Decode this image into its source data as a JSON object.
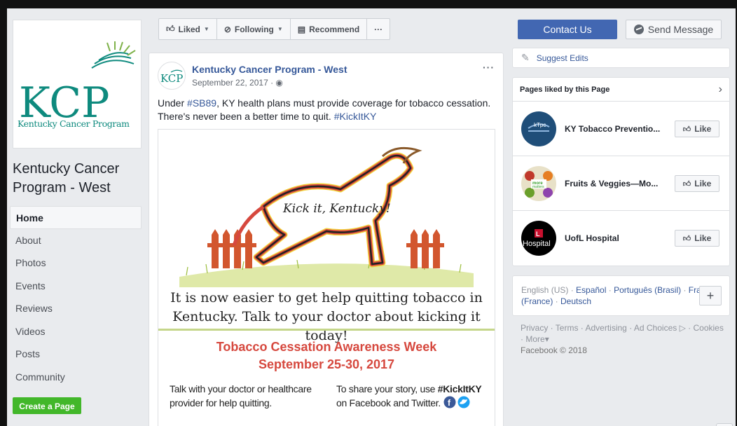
{
  "page": {
    "name": "Kentucky Cancer Program - West",
    "logo_letters": "KCP",
    "logo_tagline": "Kentucky Cancer Program"
  },
  "nav": {
    "items": [
      "Home",
      "About",
      "Photos",
      "Events",
      "Reviews",
      "Videos",
      "Posts",
      "Community"
    ],
    "active": "Home",
    "create_page": "Create a Page"
  },
  "actions": {
    "liked": "Liked",
    "following": "Following",
    "recommend": "Recommend",
    "more": "···",
    "contact_us": "Contact Us",
    "send_message": "Send Message"
  },
  "post": {
    "author": "Kentucky Cancer Program - West",
    "date": "September 22, 2017 · ",
    "more": "···",
    "text_before": "Under ",
    "tag1": "#SB89",
    "text_middle": ", KY health plans must provide coverage for tobacco cessation. There's never been a better time to quit. ",
    "tag2": "#KickItKY",
    "image": {
      "script_title": "Kick it, Kentucky!",
      "headline_line1": "It is now easier to get help quitting tobacco in",
      "headline_line2": "Kentucky. Talk to your doctor about kicking it today!",
      "title_line1": "Tobacco Cessation Awareness Week",
      "title_line2": "September 25-30, 2017",
      "left_col_line1": "Talk with your doctor or healthcare",
      "left_col_line2": "provider for help quitting.",
      "right_col_line1_before": "To share your story, use ",
      "right_col_hashtag": "#KickItKY",
      "right_col_line2": "on Facebook and Twitter.",
      "colors": {
        "title": "#d6483e",
        "rule": "#c5d68a"
      }
    }
  },
  "sidebar": {
    "suggest_edits": "Suggest Edits",
    "pages_liked_title": "Pages liked by this Page",
    "liked_pages": [
      {
        "name": "KY Tobacco Preventio...",
        "avatar_text": "kTpc",
        "avatar_bg": "#1f4e79"
      },
      {
        "name": "Fruits & Veggies—Mo...",
        "avatar_text": "more matters",
        "avatar_bg": "#e8e1c8"
      },
      {
        "name": "UofL Hospital",
        "avatar_text": "Hospital",
        "avatar_bg": "#000000"
      }
    ],
    "like_label": "Like",
    "languages": {
      "current": "English (US)",
      "options": [
        "Español",
        "Português (Brasil)",
        "Français (France)",
        "Deutsch"
      ]
    },
    "footer": {
      "links": [
        "Privacy",
        "Terms",
        "Advertising",
        "Ad Choices",
        "Cookies",
        "More"
      ],
      "copyright": "Facebook © 2018"
    }
  },
  "colors": {
    "facebook_blue": "#4267b2",
    "link_blue": "#365899",
    "create_green": "#42b72a",
    "kcp_teal": "#0e8a7e"
  }
}
